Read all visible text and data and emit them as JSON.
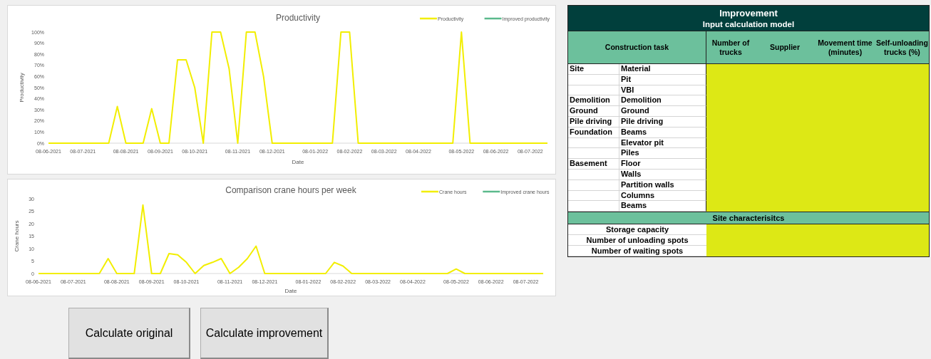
{
  "productivity_chart": {
    "chart_data": {
      "type": "line",
      "title": "Productivity",
      "xlabel": "Date",
      "ylabel": "Productivity",
      "categories": [
        "08-06-2021",
        null,
        null,
        null,
        "08-07-2021",
        null,
        null,
        null,
        null,
        "08-08-2021",
        null,
        null,
        null,
        "08-09-2021",
        null,
        null,
        null,
        "08-10-2021",
        null,
        null,
        null,
        null,
        "08-11-2021",
        null,
        null,
        null,
        "08-12-2021",
        null,
        null,
        null,
        null,
        "08-01-2022",
        null,
        null,
        null,
        "08-02-2022",
        null,
        null,
        null,
        "08-03-2022",
        null,
        null,
        null,
        "08-04-2022",
        null,
        null,
        null,
        null,
        "08-05-2022",
        null,
        null,
        null,
        "08-06-2022",
        null,
        null,
        null,
        "08-07-2022",
        null,
        null
      ],
      "series": [
        {
          "name": "Productivity",
          "color": "#f2ee00",
          "values": [
            0,
            0,
            0,
            0,
            0,
            0,
            0,
            0,
            33,
            0,
            0,
            0,
            31,
            0,
            0,
            75,
            75,
            50,
            0,
            100,
            100,
            67,
            0,
            100,
            100,
            60,
            0,
            0,
            0,
            0,
            0,
            0,
            0,
            0,
            100,
            100,
            0,
            0,
            0,
            0,
            0,
            0,
            0,
            0,
            0,
            0,
            0,
            0,
            100,
            0,
            0,
            0,
            0,
            0,
            0,
            0,
            0,
            0,
            0
          ]
        },
        {
          "name": "Improved productivity",
          "color": "#5bb98c",
          "values": [
            null,
            null,
            null,
            null,
            null,
            null,
            null,
            null,
            null,
            null,
            null,
            null,
            null,
            null,
            null,
            null,
            null,
            null,
            null,
            null,
            null,
            null,
            null,
            null,
            null,
            null,
            null,
            null,
            null,
            null,
            null,
            null,
            null,
            null,
            null,
            null,
            null,
            null,
            null,
            null,
            null,
            null,
            null,
            null,
            null,
            null,
            null,
            null,
            null,
            null,
            null,
            null,
            null,
            null,
            null,
            null,
            null,
            null,
            null
          ]
        }
      ],
      "ylim": [
        0,
        100
      ],
      "yticks": [
        {
          "value": 0,
          "label": "0%"
        },
        {
          "value": 10,
          "label": "10%"
        },
        {
          "value": 20,
          "label": "20%"
        },
        {
          "value": 30,
          "label": "30%"
        },
        {
          "value": 40,
          "label": "40%"
        },
        {
          "value": 50,
          "label": "50%"
        },
        {
          "value": 60,
          "label": "60%"
        },
        {
          "value": 70,
          "label": "70%"
        },
        {
          "value": 80,
          "label": "80%"
        },
        {
          "value": 90,
          "label": "90%"
        },
        {
          "value": 100,
          "label": "100%"
        }
      ]
    }
  },
  "crane_chart": {
    "chart_data": {
      "type": "line",
      "title": "Comparison crane hours per week",
      "xlabel": "Date",
      "ylabel": "Crane hours",
      "categories": [
        "08-06-2021",
        null,
        null,
        null,
        "08-07-2021",
        null,
        null,
        null,
        null,
        "08-08-2021",
        null,
        null,
        null,
        "08-09-2021",
        null,
        null,
        null,
        "08-10-2021",
        null,
        null,
        null,
        null,
        "08-11-2021",
        null,
        null,
        null,
        "08-12-2021",
        null,
        null,
        null,
        null,
        "08-01-2022",
        null,
        null,
        null,
        "08-02-2022",
        null,
        null,
        null,
        "08-03-2022",
        null,
        null,
        null,
        "08-04-2022",
        null,
        null,
        null,
        null,
        "08-05-2022",
        null,
        null,
        null,
        "08-06-2022",
        null,
        null,
        null,
        "08-07-2022",
        null,
        null
      ],
      "series": [
        {
          "name": "Crane hours",
          "color": "#f2ee00",
          "values": [
            0,
            0,
            0,
            0,
            0,
            0,
            0,
            0,
            6,
            0,
            0,
            0,
            27.5,
            0,
            0,
            8,
            7.5,
            4.5,
            0,
            3.2,
            4.5,
            6,
            0,
            2.5,
            6,
            11,
            0,
            0,
            0,
            0,
            0,
            0,
            0,
            0,
            4.5,
            3,
            0,
            0,
            0,
            0,
            0,
            0,
            0,
            0,
            0,
            0,
            0,
            0,
            1.8,
            0,
            0,
            0,
            0,
            0,
            0,
            0,
            0,
            0,
            0
          ]
        },
        {
          "name": "Improved crane hours",
          "color": "#5bb98c",
          "values": [
            null,
            null,
            null,
            null,
            null,
            null,
            null,
            null,
            null,
            null,
            null,
            null,
            null,
            null,
            null,
            null,
            null,
            null,
            null,
            null,
            null,
            null,
            null,
            null,
            null,
            null,
            null,
            null,
            null,
            null,
            null,
            null,
            null,
            null,
            null,
            null,
            null,
            null,
            null,
            null,
            null,
            null,
            null,
            null,
            null,
            null,
            null,
            null,
            null,
            null,
            null,
            null,
            null,
            null,
            null,
            null,
            null,
            null,
            null
          ]
        }
      ],
      "ylim": [
        0,
        30
      ],
      "yticks": [
        0,
        5,
        10,
        15,
        20,
        25,
        30
      ]
    }
  },
  "buttons": [
    "Calculate original",
    "Calculate improvement"
  ],
  "table": {
    "title": "Improvement",
    "subtitle": "Input calculation model",
    "columns": [
      "Construction task",
      "Number of trucks",
      "Supplier",
      "Movement time (minutes)",
      "Self-unloading trucks (%)"
    ],
    "task_rows": [
      {
        "group": "Site",
        "task": "Material"
      },
      {
        "task": "Pit"
      },
      {
        "task": "VBI"
      },
      {
        "group": "Demolition",
        "task": "Demolition"
      },
      {
        "group": "Ground",
        "task": "Ground"
      },
      {
        "group": "Pile driving",
        "task": "Pile driving"
      },
      {
        "group": "Foundation",
        "task": "Beams"
      },
      {
        "task": "Elevator pit"
      },
      {
        "task": "Piles"
      },
      {
        "group": "Basement",
        "task": "Floor"
      },
      {
        "task": "Walls"
      },
      {
        "task": "Partition walls"
      },
      {
        "task": "Columns"
      },
      {
        "task": "Beams"
      }
    ],
    "section_title": "Site characterisitcs",
    "characteristic_rows": [
      "Storage capacity",
      "Number of unloading spots",
      "Number of waiting spots"
    ]
  }
}
